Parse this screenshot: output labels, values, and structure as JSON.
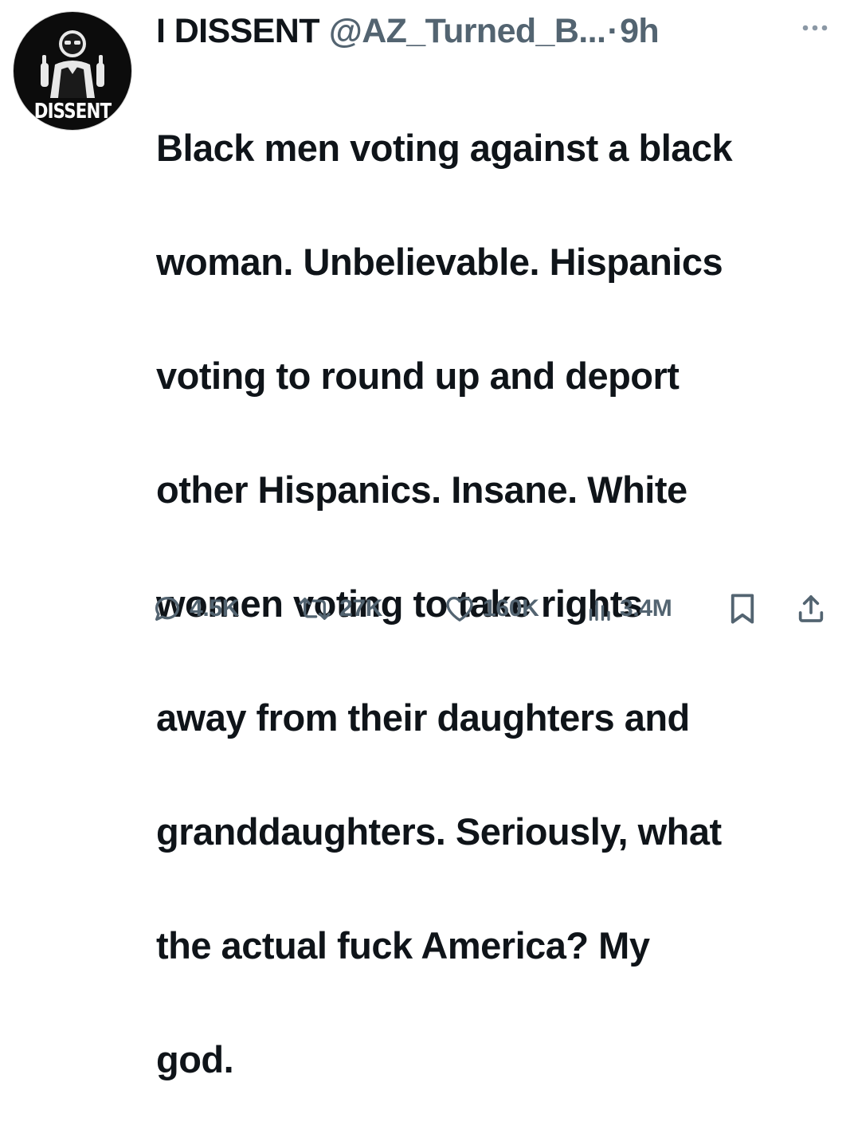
{
  "user": {
    "display_name": "I DISSENT",
    "handle": "@AZ_Turned_B...",
    "separator": "·",
    "time": "9h",
    "avatar_icon": "dissent-avatar-icon",
    "avatar_text": "DISSENT"
  },
  "menu": {
    "icon": "more-horizontal-icon"
  },
  "tweet": {
    "lines": [
      "Black men voting against a black",
      "woman. Unbelievable. Hispanics",
      "voting to round up and deport",
      "other Hispanics. Insane. White",
      "women voting to take rights",
      "away from their daughters and",
      "granddaughters. Seriously, what",
      "the actual fuck America? My",
      "god."
    ]
  },
  "actions": {
    "reply": {
      "icon": "reply-icon",
      "count": "4.5K"
    },
    "retweet": {
      "icon": "retweet-icon",
      "count": "27K"
    },
    "like": {
      "icon": "heart-icon",
      "count": "160K"
    },
    "views": {
      "icon": "views-icon",
      "count": "3.4M"
    },
    "bookmark": {
      "icon": "bookmark-icon"
    },
    "share": {
      "icon": "share-icon"
    }
  },
  "colors": {
    "text_primary": "#0f1419",
    "text_secondary": "#536471",
    "background": "#ffffff"
  }
}
